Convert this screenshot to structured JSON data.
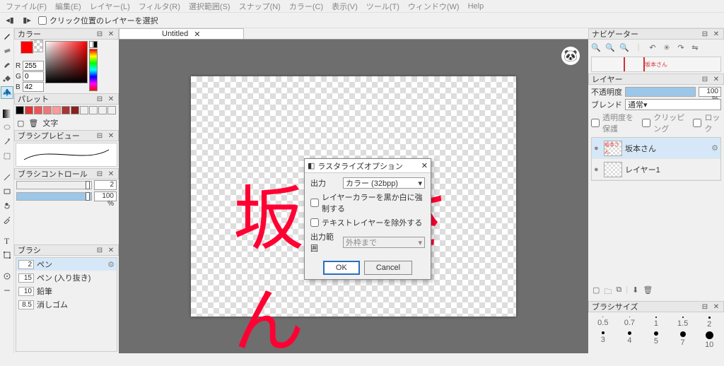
{
  "menubar": [
    "ファイル(F)",
    "編集(E)",
    "レイヤー(L)",
    "フィルタ(R)",
    "選択範囲(S)",
    "スナップ(N)",
    "カラー(C)",
    "表示(V)",
    "ツール(T)",
    "ウィンドウ(W)",
    "Help"
  ],
  "optbar": {
    "checkbox_label": "クリック位置のレイヤーを選択"
  },
  "tab": {
    "title": "Untitled"
  },
  "panels": {
    "color": {
      "title": "カラー",
      "R": "255",
      "G": "0",
      "B": "42"
    },
    "palette": {
      "title": "パレット",
      "colors": [
        "#000",
        "#d33",
        "#e55",
        "#e77",
        "#f99",
        "#a33",
        "#822"
      ],
      "text_btn": "文字"
    },
    "brushprev": {
      "title": "ブラシプレビュー"
    },
    "brushctrl": {
      "title": "ブラシコントロール",
      "size": "2",
      "pct": "100 %"
    },
    "brush": {
      "title": "ブラシ",
      "items": [
        {
          "n": "2",
          "name": "ペン"
        },
        {
          "n": "15",
          "name": "ペン (入り抜き)"
        },
        {
          "n": "10",
          "name": "鉛筆"
        },
        {
          "n": "8.5",
          "name": "消しゴム"
        }
      ]
    },
    "navigator": {
      "title": "ナビゲーター"
    },
    "layer": {
      "title": "レイヤー",
      "opacity_label": "不透明度",
      "opacity_val": "100 %",
      "blend_label": "ブレンド",
      "blend_val": "通常",
      "protect": "透明度を保護",
      "clip": "クリッピング",
      "lock": "ロック",
      "items": [
        {
          "name": "坂本さん"
        },
        {
          "name": "レイヤー1"
        }
      ]
    },
    "brushsize": {
      "title": "ブラシサイズ",
      "row1": [
        "0.5",
        "0.7",
        "1",
        "1.5",
        "2"
      ],
      "row2": [
        "3",
        "4",
        "5",
        "7",
        "10"
      ]
    }
  },
  "dialog": {
    "title": "ラスタライズオプション",
    "output_label": "出力",
    "output_value": "カラー (32bpp)",
    "opt1": "レイヤーカラーを黒か白に強制する",
    "opt2": "テキストレイヤーを除外する",
    "range_label": "出力範囲",
    "range_value": "外枠まで",
    "ok": "OK",
    "cancel": "Cancel"
  },
  "canvas_text": "坂本さん"
}
